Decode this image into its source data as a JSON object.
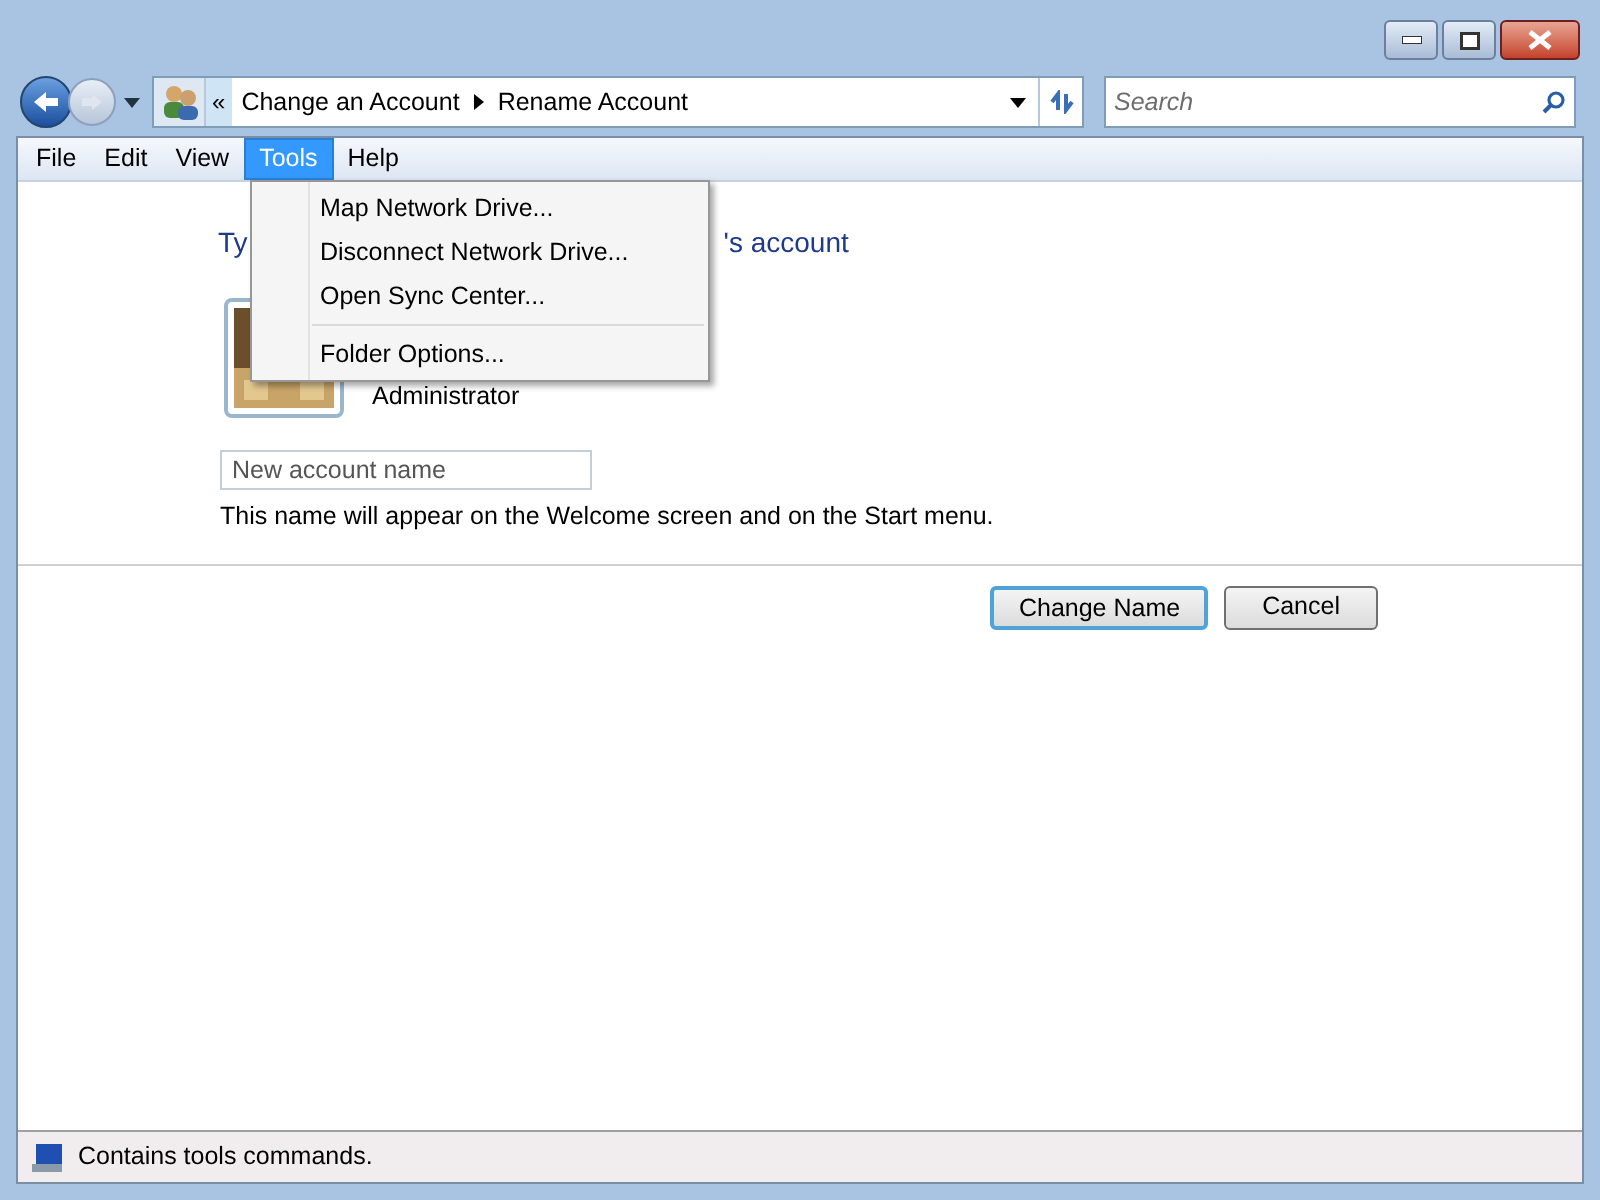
{
  "address_bar": {
    "overflow": "«",
    "breadcrumbs": [
      "Change an Account",
      "Rename Account"
    ]
  },
  "search": {
    "placeholder": "Search"
  },
  "menu_bar": [
    {
      "label": "File",
      "selected": false
    },
    {
      "label": "Edit",
      "selected": false
    },
    {
      "label": "View",
      "selected": false
    },
    {
      "label": "Tools",
      "selected": true
    },
    {
      "label": "Help",
      "selected": false
    }
  ],
  "tools_menu": [
    {
      "kind": "item",
      "label": "Map Network Drive..."
    },
    {
      "kind": "item",
      "label": "Disconnect Network Drive..."
    },
    {
      "kind": "item",
      "label": "Open Sync Center..."
    },
    {
      "kind": "separator"
    },
    {
      "kind": "item",
      "label": "Folder Options..."
    }
  ],
  "heading_visible_start": "Ty",
  "heading_visible_end": "'s account",
  "account": {
    "name": "Administrator"
  },
  "name_field": {
    "placeholder": "New account name"
  },
  "hint": "This name will appear on the Welcome screen and on the Start menu.",
  "buttons": [
    {
      "label": "Change Name",
      "default": true
    },
    {
      "label": "Cancel",
      "default": false
    }
  ],
  "status_bar": "Contains tools commands."
}
